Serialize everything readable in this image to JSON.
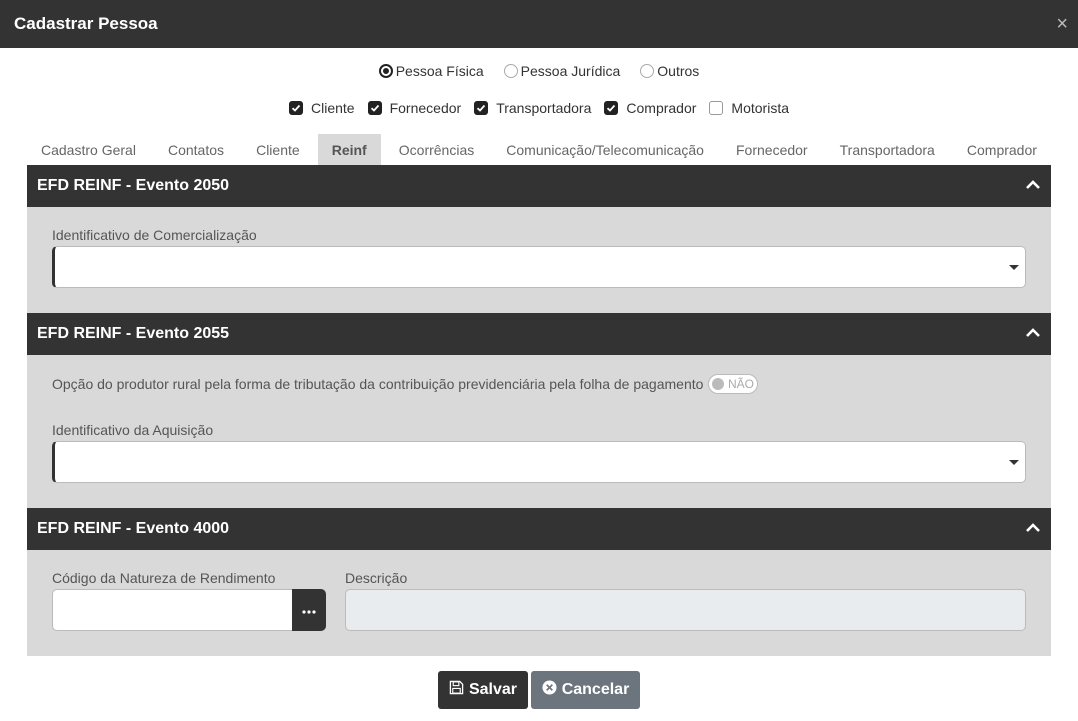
{
  "dialog": {
    "title": "Cadastrar Pessoa",
    "close": "×"
  },
  "person_type": {
    "options": [
      {
        "label": "Pessoa Física",
        "selected": true
      },
      {
        "label": "Pessoa Jurídica",
        "selected": false
      },
      {
        "label": "Outros",
        "selected": false
      }
    ]
  },
  "roles": {
    "options": [
      {
        "label": "Cliente",
        "checked": true
      },
      {
        "label": "Fornecedor",
        "checked": true
      },
      {
        "label": "Transportadora",
        "checked": true
      },
      {
        "label": "Comprador",
        "checked": true
      },
      {
        "label": "Motorista",
        "checked": false
      }
    ]
  },
  "tabs": [
    {
      "label": "Cadastro Geral",
      "active": false
    },
    {
      "label": "Contatos",
      "active": false
    },
    {
      "label": "Cliente",
      "active": false
    },
    {
      "label": "Reinf",
      "active": true
    },
    {
      "label": "Ocorrências",
      "active": false
    },
    {
      "label": "Comunicação/Telecomunicação",
      "active": false
    },
    {
      "label": "Fornecedor",
      "active": false
    },
    {
      "label": "Transportadora",
      "active": false
    },
    {
      "label": "Comprador",
      "active": false
    }
  ],
  "sections": {
    "s2050": {
      "title": "EFD REINF - Evento 2050",
      "field_label": "Identificativo de Comercialização",
      "value": ""
    },
    "s2055": {
      "title": "EFD REINF - Evento 2055",
      "option_text": "Opção do produtor rural pela forma de tributação da contribuição previdenciária pela folha de pagamento",
      "toggle_label": "NÃO",
      "field_label": "Identificativo da Aquisição",
      "value": ""
    },
    "s4000": {
      "title": "EFD REINF - Evento 4000",
      "code_label": "Código da Natureza de Rendimento",
      "code_value": "",
      "desc_label": "Descrição",
      "desc_value": ""
    }
  },
  "footer": {
    "save_label": "Salvar",
    "cancel_label": "Cancelar"
  },
  "colors": {
    "header": "#333333",
    "section_bg": "#d9d9d9",
    "cancel": "#6c757d"
  }
}
